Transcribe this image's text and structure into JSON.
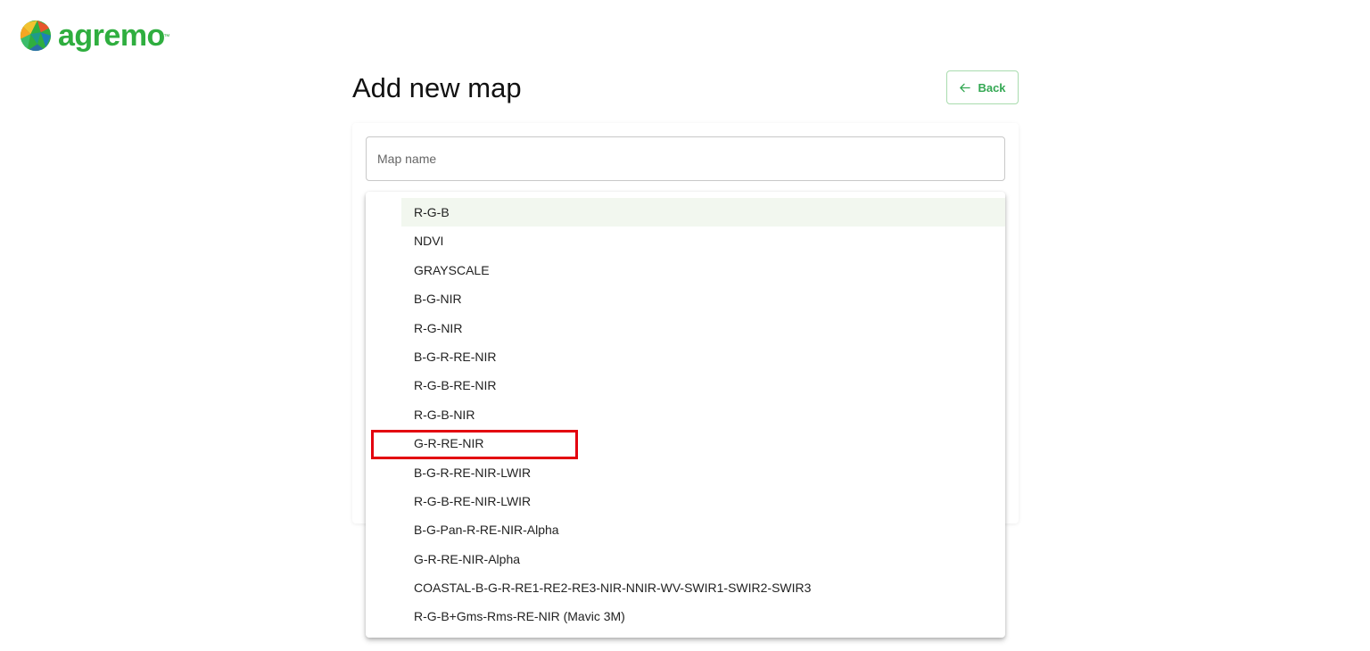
{
  "brand": {
    "name": "agremo",
    "trademark": "™",
    "logo_icon": "agremo-logo-icon",
    "color": "#2fae3f"
  },
  "header": {
    "title": "Add new map",
    "back_label": "Back",
    "back_icon": "arrow-left-icon"
  },
  "form": {
    "map_name": {
      "placeholder": "Map name",
      "value": ""
    }
  },
  "band_dropdown": {
    "selected_index": 0,
    "options": [
      "R-G-B",
      "NDVI",
      "GRAYSCALE",
      "B-G-NIR",
      "R-G-NIR",
      "B-G-R-RE-NIR",
      "R-G-B-RE-NIR",
      "R-G-B-NIR",
      "G-R-RE-NIR",
      "B-G-R-RE-NIR-LWIR",
      "R-G-B-RE-NIR-LWIR",
      "B-G-Pan-R-RE-NIR-Alpha",
      "G-R-RE-NIR-Alpha",
      "COASTAL-B-G-R-RE1-RE2-RE3-NIR-NNIR-WV-SWIR1-SWIR2-SWIR3",
      "R-G-B+Gms-Rms-RE-NIR (Mavic 3M)"
    ]
  },
  "annotation": {
    "highlighted_option": "G-R-RE-NIR",
    "color": "#e3000f"
  },
  "colors": {
    "accent": "#34a853",
    "selected_row": "#f2f7ef"
  }
}
